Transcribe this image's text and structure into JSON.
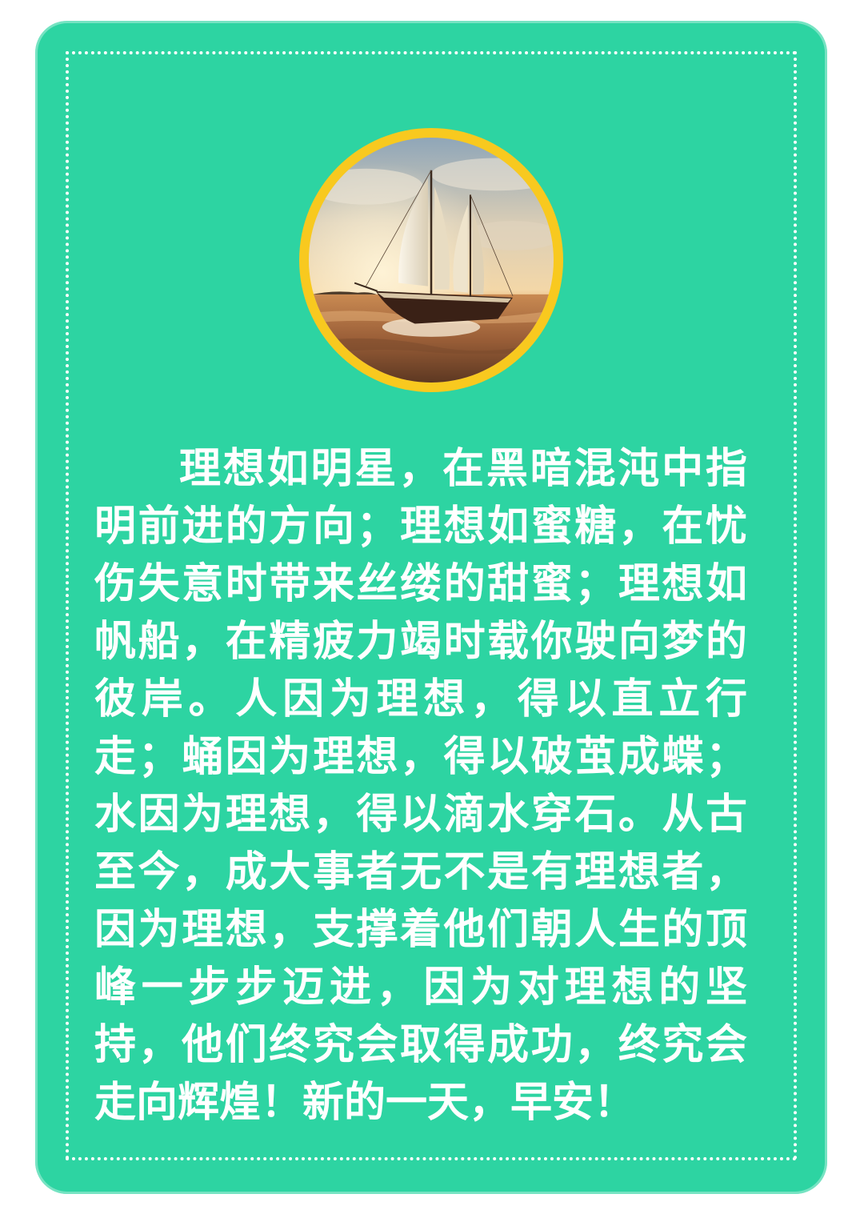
{
  "card": {
    "background_color": "#2dd4a2",
    "frame_color": "#ffffff",
    "ring_color": "#f8c91f"
  },
  "image": {
    "subject": "sailboat-at-sea-photo"
  },
  "passage": {
    "text": "理想如明星，在黑暗混沌中指明前进的方向；理想如蜜糖，在忧伤失意时带来丝缕的甜蜜；理想如帆船，在精疲力竭时载你驶向梦的彼岸。人因为理想，得以直立行走；蛹因为理想，得以破茧成蝶；水因为理想，得以滴水穿石。从古至今，成大事者无不是有理想者，因为理想，支撑着他们朝人生的顶峰一步步迈进，因为对理想的坚持，他们终究会取得成功，终究会走向辉煌！新的一天，早安！"
  }
}
